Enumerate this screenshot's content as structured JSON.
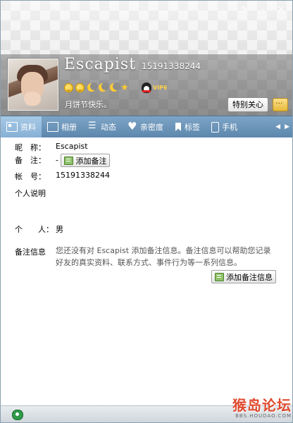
{
  "profile": {
    "nickname": "Escapist",
    "qq_number": "15191338244",
    "signature": "月饼节快乐。",
    "level_icons": [
      "sun-icon",
      "sun-icon",
      "moon-icon",
      "moon-icon",
      "moon-icon",
      "star-icon"
    ],
    "vip_label": "VIP6",
    "care_button": "特别关心"
  },
  "tabs": [
    {
      "label": "资料",
      "icon": "card-icon",
      "active": true
    },
    {
      "label": "相册",
      "icon": "photo-icon",
      "active": false
    },
    {
      "label": "动态",
      "icon": "list-icon",
      "active": false
    },
    {
      "label": "亲密度",
      "icon": "heart-icon",
      "active": false
    },
    {
      "label": "标签",
      "icon": "tag-icon",
      "active": false
    },
    {
      "label": "手机",
      "icon": "phone-icon",
      "active": false
    }
  ],
  "details": {
    "nickname_label": "昵　称：",
    "nickname_value": "Escapist",
    "remark_label": "备　注：",
    "remark_value": "-",
    "add_remark_button": "添加备注",
    "account_label": "帐　号：",
    "account_value": "15191338244",
    "bio_label": "个人说明",
    "personal_label": "个　　人：",
    "personal_value": "男",
    "note_info_label": "备注信息",
    "note_info_desc": "您还没有对 Escapist 添加备注信息。备注信息可以帮助您记录好友的真实资料、联系方式、事件行为等一系列信息。",
    "add_note_info_button": "添加备注信息"
  },
  "watermark": {
    "logo": "猴岛论坛",
    "url": "BBS.HOUDAO.COM"
  },
  "colors": {
    "tab_bar": "#6b93b8",
    "tab_active": "#98bee0",
    "watermark": "#e04a2e"
  }
}
